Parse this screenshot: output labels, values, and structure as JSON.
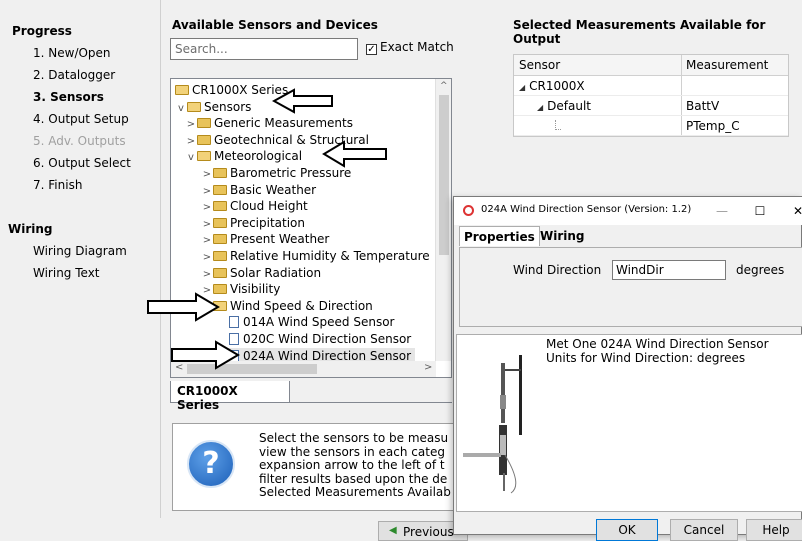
{
  "nav": {
    "progress_heading": "Progress",
    "steps": [
      {
        "label": "1. New/Open",
        "state": "normal"
      },
      {
        "label": "2. Datalogger",
        "state": "normal"
      },
      {
        "label": "3. Sensors",
        "state": "active"
      },
      {
        "label": "4. Output Setup",
        "state": "normal"
      },
      {
        "label": "5. Adv. Outputs",
        "state": "disabled"
      },
      {
        "label": "6. Output Select",
        "state": "normal"
      },
      {
        "label": "7. Finish",
        "state": "normal"
      }
    ],
    "wiring_heading": "Wiring",
    "wiring_items": [
      "Wiring Diagram",
      "Wiring Text"
    ]
  },
  "available": {
    "title": "Available Sensors and Devices",
    "search_placeholder": "Search...",
    "exact_match_label": "Exact Match",
    "exact_match_checked": true,
    "tree": [
      {
        "label": "CR1000X Series",
        "level": 0,
        "icon": "folder-open",
        "expander": ""
      },
      {
        "label": "Sensors",
        "level": 0,
        "icon": "folder-open",
        "expander": "v"
      },
      {
        "label": "Generic Measurements",
        "level": 1,
        "icon": "folder",
        "expander": ">"
      },
      {
        "label": "Geotechnical & Structural",
        "level": 1,
        "icon": "folder",
        "expander": ">"
      },
      {
        "label": "Meteorological",
        "level": 1,
        "icon": "folder-open",
        "expander": "v"
      },
      {
        "label": "Barometric Pressure",
        "level": 2,
        "icon": "folder",
        "expander": ">"
      },
      {
        "label": "Basic Weather",
        "level": 2,
        "icon": "folder",
        "expander": ">"
      },
      {
        "label": "Cloud Height",
        "level": 2,
        "icon": "folder",
        "expander": ">"
      },
      {
        "label": "Precipitation",
        "level": 2,
        "icon": "folder",
        "expander": ">"
      },
      {
        "label": "Present Weather",
        "level": 2,
        "icon": "folder",
        "expander": ">"
      },
      {
        "label": "Relative Humidity & Temperature",
        "level": 2,
        "icon": "folder",
        "expander": ">"
      },
      {
        "label": "Solar Radiation",
        "level": 2,
        "icon": "folder",
        "expander": ">"
      },
      {
        "label": "Visibility",
        "level": 2,
        "icon": "folder",
        "expander": ">"
      },
      {
        "label": "Wind Speed & Direction",
        "level": 2,
        "icon": "folder-open",
        "expander": "v"
      },
      {
        "label": "014A Wind Speed Sensor",
        "level": 3,
        "icon": "document",
        "expander": ""
      },
      {
        "label": "020C Wind Direction Sensor",
        "level": 3,
        "icon": "document",
        "expander": ""
      },
      {
        "label": "024A Wind Direction Sensor",
        "level": 3,
        "icon": "document",
        "expander": "",
        "selected": true
      }
    ],
    "tab_label": "CR1000X Series",
    "help_text": "Select the sensors to be measu\nview the sensors in each categ\nexpansion arrow to the left of t\nfilter results based upon the de\nSelected Measurements Availab",
    "previous_label": "Previous"
  },
  "selected": {
    "title": "Selected Measurements Available for Output",
    "columns": [
      "Sensor",
      "Measurement"
    ],
    "rows": [
      {
        "sensor": "CR1000X",
        "measurement": "",
        "indent": 0,
        "expander": "◢"
      },
      {
        "sensor": "Default",
        "measurement": "BattV",
        "indent": 1,
        "expander": "◢"
      },
      {
        "sensor": "",
        "measurement": "PTemp_C",
        "indent": 2,
        "expander": ""
      }
    ]
  },
  "dialog": {
    "title": "024A Wind Direction Sensor (Version: 1.2)",
    "minimize": "—",
    "maximize": "☐",
    "close": "✕",
    "tabs": [
      "Properties",
      "Wiring"
    ],
    "active_tab": "Properties",
    "field_label": "Wind Direction",
    "field_value": "WindDir",
    "field_unit": "degrees",
    "description_line1": "Met One 024A Wind Direction Sensor",
    "description_line2": "Units for Wind Direction: degrees",
    "buttons": {
      "ok": "OK",
      "cancel": "Cancel",
      "help": "Help"
    }
  }
}
